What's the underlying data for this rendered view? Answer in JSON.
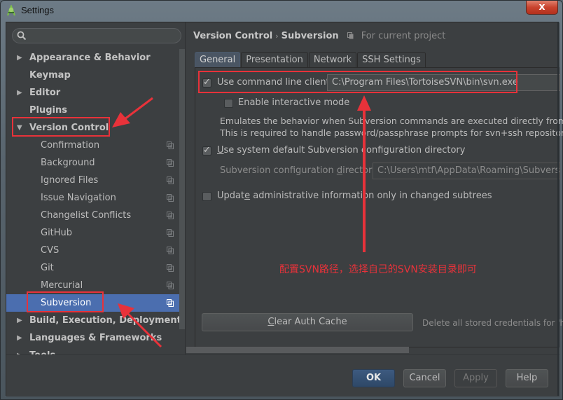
{
  "window": {
    "title": "Settings",
    "close_label": "x"
  },
  "sidebar": {
    "search_placeholder": "",
    "items": [
      {
        "label": "Appearance & Behavior",
        "level": 0,
        "expander": "collapsed"
      },
      {
        "label": "Keymap",
        "level": 0,
        "expander": "none"
      },
      {
        "label": "Editor",
        "level": 0,
        "expander": "collapsed"
      },
      {
        "label": "Plugins",
        "level": 0,
        "expander": "none"
      },
      {
        "label": "Version Control",
        "level": 0,
        "expander": "expanded"
      },
      {
        "label": "Confirmation",
        "level": 1
      },
      {
        "label": "Background",
        "level": 1
      },
      {
        "label": "Ignored Files",
        "level": 1
      },
      {
        "label": "Issue Navigation",
        "level": 1
      },
      {
        "label": "Changelist Conflicts",
        "level": 1
      },
      {
        "label": "GitHub",
        "level": 1
      },
      {
        "label": "CVS",
        "level": 1
      },
      {
        "label": "Git",
        "level": 1
      },
      {
        "label": "Mercurial",
        "level": 1
      },
      {
        "label": "Subversion",
        "level": 1,
        "selected": true
      },
      {
        "label": "Build, Execution, Deployment",
        "level": 0,
        "expander": "collapsed"
      },
      {
        "label": "Languages & Frameworks",
        "level": 0,
        "expander": "collapsed"
      },
      {
        "label": "Tools",
        "level": 0,
        "expander": "collapsed"
      }
    ]
  },
  "breadcrumb": {
    "parent": "Version Control",
    "separator": "›",
    "current": "Subversion",
    "scope": "For current project"
  },
  "tabs": [
    {
      "label": "General",
      "active": true
    },
    {
      "label": "Presentation",
      "active": false
    },
    {
      "label": "Network",
      "active": false
    },
    {
      "label": "SSH Settings",
      "active": false
    }
  ],
  "general": {
    "use_cmd_client": {
      "label": "Use command line client:",
      "checked": true,
      "value": "C:\\Program Files\\TortoiseSVN\\bin\\svn.exe"
    },
    "interactive_mode": {
      "label": "Enable interactive mode",
      "checked": false
    },
    "interactive_desc_1": "Emulates the behavior when Subversion commands are executed directly from the t",
    "interactive_desc_2": "This is required to handle password/passphrase prompts for svn+ssh repositories,",
    "use_system_default": {
      "label_u": "U",
      "label_rest": "se system default Subversion configuration directory",
      "checked": true
    },
    "config_dir": {
      "label_pre": "Subversion configuration ",
      "label_u": "d",
      "label_post": "irectory:",
      "value": "C:\\Users\\mtf\\AppData\\Roaming\\Subversion"
    },
    "update_admin": {
      "label_pre": "Updat",
      "label_u": "e",
      "label_post": " administrative information only in changed subtrees",
      "checked": false
    },
    "clear_auth": {
      "label_u": "C",
      "label_rest": "lear Auth Cache"
    },
    "clear_auth_desc": "Delete all stored credentials for 'http',"
  },
  "footer": {
    "ok": "OK",
    "cancel": "Cancel",
    "apply": "Apply",
    "help": "Help"
  },
  "annotation": {
    "text": "配置SVN路径，选择自己的SVN安装目录即可",
    "color": "#e8323a"
  },
  "colors": {
    "background": "#3c3f41",
    "selection": "#4b6eaf",
    "primary_button": "#3d5a80"
  }
}
